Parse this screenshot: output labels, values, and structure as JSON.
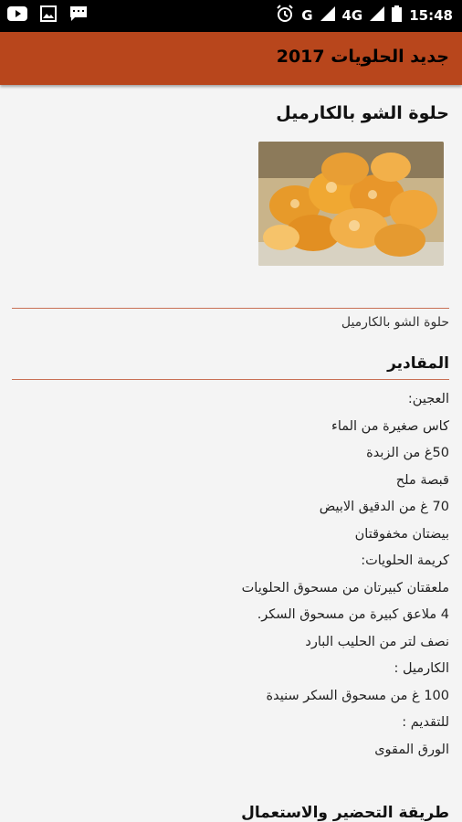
{
  "statusbar": {
    "time": "15:48",
    "network": "4G",
    "carrier_letter": "G",
    "icons": [
      "youtube-icon",
      "image-icon",
      "message-icon",
      "alarm-icon",
      "signal-icon",
      "battery-icon"
    ]
  },
  "appbar": {
    "title": "جديد الحلويات 2017",
    "background": "#b8461c"
  },
  "article": {
    "title": "حلوة الشو بالكارميل",
    "image_desc": "caramel choux pastries",
    "subtitle": "حلوة الشو بالكارميل",
    "ingredients_heading": "المقادير",
    "ingredients": [
      "العجين:",
      "كاس صغيرة من الماء",
      "50غ من الزبدة",
      "قبصة ملح",
      "70 غ من الدقيق الابيض",
      "بيضتان مخفوقتان",
      "كريمة الحلويات:",
      "ملعقتان كبيرتان من مسحوق الحلويات",
      "4 ملاعق كبيرة من مسحوق السكر.",
      "نصف لتر من الحليب البارد",
      "الكارميل :",
      "100 غ من مسحوق السكر سنيدة",
      "للتقديم :",
      "الورق المقوى"
    ],
    "method_heading": "طريقة التحضير والاستعمال",
    "divider_color": "#c87055"
  }
}
